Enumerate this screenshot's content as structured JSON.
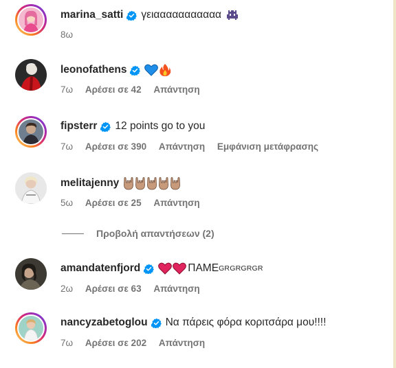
{
  "comments": [
    {
      "username": "marina_satti",
      "text": "γειααααααααααα",
      "time": "8ω",
      "emoji_icons": [
        "alien-monster-icon"
      ]
    },
    {
      "username": "leonofathens",
      "text": "",
      "time": "7ω",
      "likes": "Αρέσει σε 42",
      "reply": "Απάντηση",
      "emoji_icons": [
        "blue-heart-icon",
        "fire-icon"
      ]
    },
    {
      "username": "fipsterr",
      "text": "12 points go to you",
      "time": "7ω",
      "likes": "Αρέσει σε 390",
      "reply": "Απάντηση",
      "translate": "Εμφάνιση μετάφρασης"
    },
    {
      "username": "melitajenny",
      "text": "",
      "time": "5ω",
      "likes": "Αρέσει σε 25",
      "reply": "Απάντηση",
      "emoji_icons": [
        "sign-of-horns-icon",
        "sign-of-horns-icon",
        "sign-of-horns-icon",
        "sign-of-horns-icon",
        "sign-of-horns-icon"
      ]
    },
    {
      "username": "amandatenfjord",
      "text_main": "ΠΑΜΕ",
      "text_small": "GRGRGRGR",
      "time": "2ω",
      "likes": "Αρέσει σε 63",
      "reply": "Απάντηση",
      "emoji_icons": [
        "red-heart-icon",
        "red-heart-icon"
      ]
    },
    {
      "username": "nancyzabetoglou",
      "text": "Να πάρεις φόρα κοριτσάρα μου!!!!",
      "time": "7ω",
      "likes": "Αρέσει σε 202",
      "reply": "Απάντηση"
    }
  ],
  "view_replies": "Προβολή απαντήσεων (2)",
  "colors": {
    "text": "#262626",
    "meta": "#737373",
    "verified": "#0095f6"
  }
}
